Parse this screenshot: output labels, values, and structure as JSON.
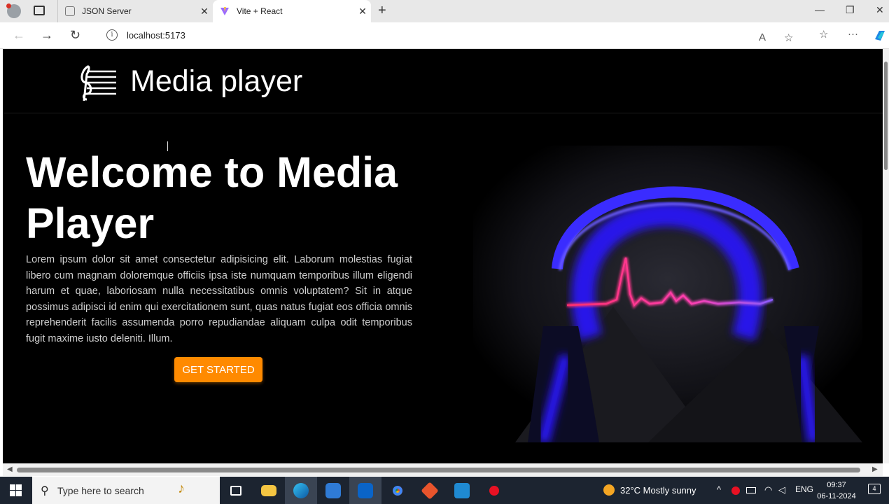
{
  "browser": {
    "tabs": [
      {
        "title": "JSON Server",
        "close": "✕"
      },
      {
        "title": "Vite + React",
        "close": "✕"
      }
    ],
    "new_tab": "+",
    "window_controls": {
      "minimize": "—",
      "maximize": "❐",
      "close": "✕"
    },
    "nav": {
      "back": "←",
      "forward": "→",
      "reload": "↻"
    },
    "url": "localhost:5173",
    "info_glyph": "i",
    "omni_icons": {
      "read_aloud": "A",
      "favorite": "☆",
      "favorites": "☆",
      "more": "···"
    }
  },
  "page": {
    "brand": "Media player",
    "hero_title": "Welcome to Media Player",
    "hero_text": "Lorem ipsum dolor sit amet consectetur adipisicing elit. Laborum molestias fugiat libero cum magnam doloremque officiis ipsa iste numquam temporibus illum eligendi harum et quae, laboriosam nulla necessitatibus omnis voluptatem? Sit in atque possimus adipisci id enim qui exercitationem sunt, quas natus fugiat eos officia omnis reprehenderit facilis assumenda porro repudiandae aliquam culpa odit temporibus fugit maxime iusto deleniti. Illum.",
    "cta_label": "GET STARTED"
  },
  "scrollbars": {
    "left_arrow": "◀",
    "right_arrow": "▶"
  },
  "taskbar": {
    "search_placeholder": "Type here to search",
    "search_icon": "⚲",
    "weather": "32°C  Mostly sunny",
    "language": "ENG",
    "time": "09:37",
    "date": "06-11-2024",
    "tray_chevron": "^",
    "notification_count": "4"
  },
  "colors": {
    "accent_button": "#ff8a00",
    "page_background": "#000000",
    "headphone_glow": "#2a1cff",
    "waveform": "#ff2f7a"
  }
}
